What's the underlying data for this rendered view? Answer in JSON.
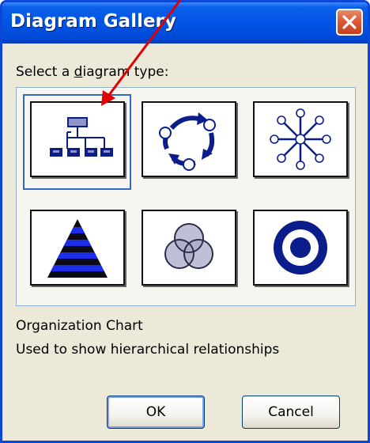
{
  "window": {
    "title": "Diagram Gallery",
    "close_icon": "close-icon",
    "accent_color": "#0a46d8",
    "close_color": "#dc5a38"
  },
  "gallery": {
    "prompt_prefix": "Select a ",
    "prompt_underlined": "d",
    "prompt_suffix": "iagram type:",
    "selected_index": 0,
    "items": [
      {
        "icon": "organization-chart-icon"
      },
      {
        "icon": "cycle-diagram-icon"
      },
      {
        "icon": "radial-diagram-icon"
      },
      {
        "icon": "pyramid-diagram-icon"
      },
      {
        "icon": "venn-diagram-icon"
      },
      {
        "icon": "target-diagram-icon"
      }
    ],
    "icon_color": "#0b1d8a",
    "selection_color": "#316ac5"
  },
  "description": {
    "name": "Organization Chart",
    "text": "Used to show hierarchical relationships"
  },
  "buttons": {
    "ok_label": "OK",
    "cancel_label": "Cancel"
  },
  "annotation": {
    "arrow_color": "#e00000"
  }
}
